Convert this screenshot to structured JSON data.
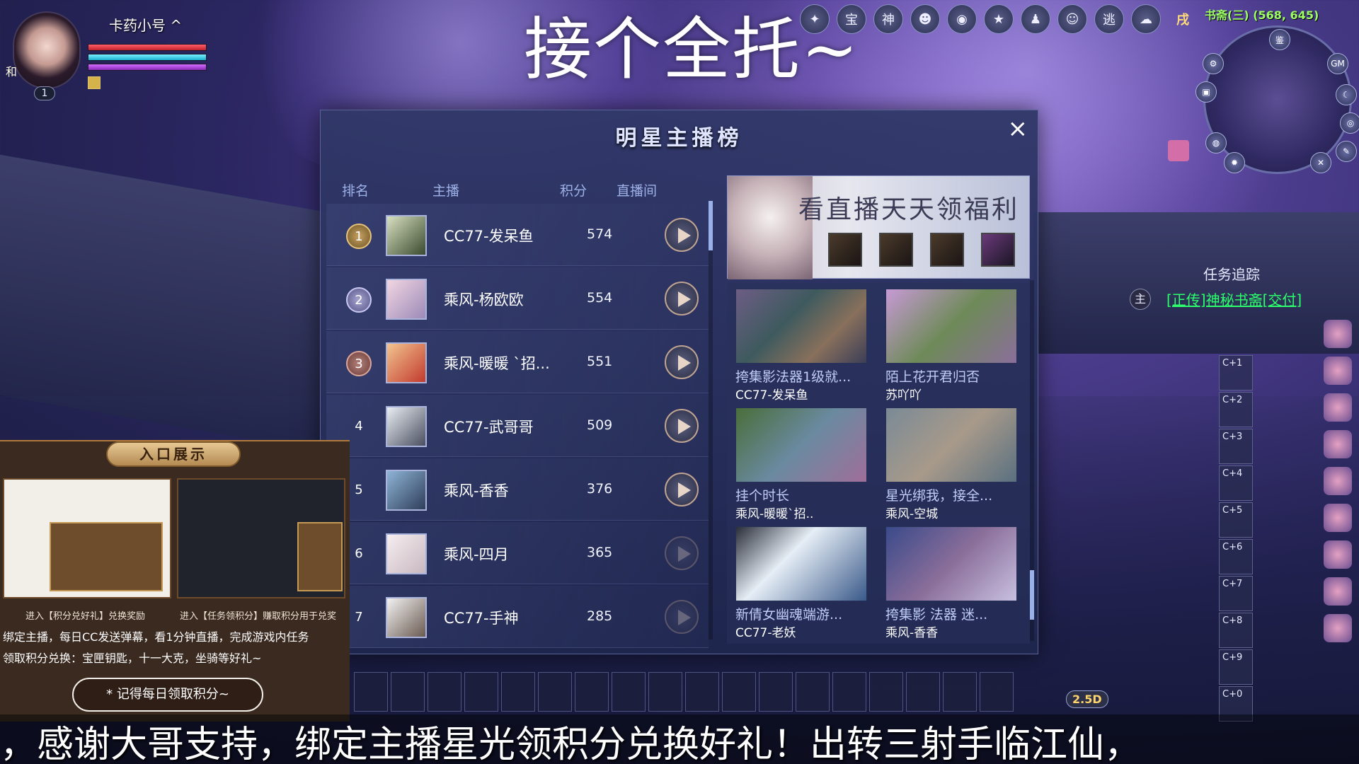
{
  "overlay_title": "接个全托~",
  "player": {
    "name": "卡药小号 ^",
    "level": "1",
    "tag": "和"
  },
  "top_icons": [
    {
      "icon": "wing-icon",
      "label": ""
    },
    {
      "icon": "treasure-icon",
      "label": "宝"
    },
    {
      "icon": "god-icon",
      "label": "神"
    },
    {
      "icon": "mask-icon",
      "label": ""
    },
    {
      "icon": "camera-icon",
      "label": ""
    },
    {
      "icon": "star-shield-icon",
      "label": ""
    },
    {
      "icon": "figure-icon",
      "label": ""
    },
    {
      "icon": "face-icon",
      "label": ""
    },
    {
      "icon": "escape-icon",
      "label": "逃"
    },
    {
      "icon": "cloud-icon",
      "label": ""
    },
    {
      "icon": "zodiac-icon",
      "label": "戌"
    }
  ],
  "coords": "书斋(三) (568, 645)",
  "minimap_buttons": [
    "鉴",
    "GM"
  ],
  "panel": {
    "title": "明星主播榜",
    "close": "×",
    "columns": [
      "排名",
      "主播",
      "积分",
      "直播间"
    ],
    "rows": [
      {
        "rank": "1",
        "streamer": "CC77-发呆鱼",
        "score": "574"
      },
      {
        "rank": "2",
        "streamer": "乘风-杨欧欧",
        "score": "554"
      },
      {
        "rank": "3",
        "streamer": "乘风-暖暖 `招...",
        "score": "551"
      },
      {
        "rank": "4",
        "streamer": "CC77-武哥哥",
        "score": "509"
      },
      {
        "rank": "5",
        "streamer": "乘风-香香",
        "score": "376"
      },
      {
        "rank": "6",
        "streamer": "乘风-四月",
        "score": "365"
      },
      {
        "rank": "7",
        "streamer": "CC77-手神",
        "score": "285"
      }
    ],
    "banner_text": "看直播天天领福利",
    "videos": [
      {
        "title": "挎集影法器1级就...",
        "anchor": "CC77-发呆鱼"
      },
      {
        "title": "陌上花开君归否",
        "anchor": "苏吖吖"
      },
      {
        "title": "挂个时长",
        "anchor": "乘风-暖暖`招.."
      },
      {
        "title": "星光绑我，接全...",
        "anchor": "乘风-空城"
      },
      {
        "title": "新倩女幽魂端游...",
        "anchor": "CC77-老妖"
      },
      {
        "title": "挎集影 法器 迷...",
        "anchor": "乘风-香香"
      }
    ]
  },
  "task": {
    "title": "任务追踪",
    "tag": "主",
    "line": "[正传]神秘书斋[交付]"
  },
  "hotkeys": [
    "C+1",
    "C+2",
    "C+3",
    "C+4",
    "C+5",
    "C+6",
    "C+7",
    "C+8",
    "C+9",
    "C+0"
  ],
  "version_badge": "2.5D",
  "promo": {
    "header": "入口展示",
    "caption_left": "进入【积分兑好礼】兑换奖励",
    "caption_right": "进入【任务领积分】赚取积分用于兑奖",
    "body_line1": "绑定主播，每日CC发送弹幕，看1分钟直播，完成游戏内任务",
    "body_line2": "领取积分兑换：宝匣钥匙，十一大克，坐骑等好礼~",
    "button": "* 记得每日领取积分~"
  },
  "subtitle": "，感谢大哥支持，绑定主播星光领积分兑换好礼！出转三射手临江仙，"
}
